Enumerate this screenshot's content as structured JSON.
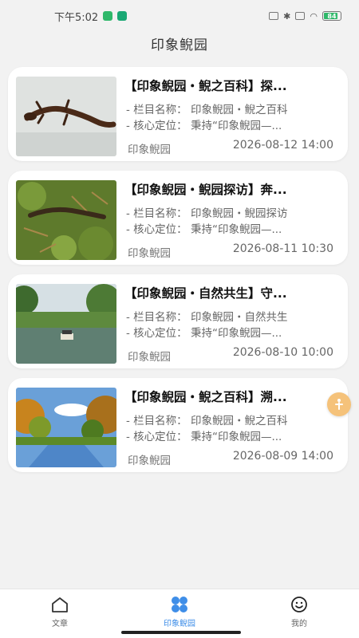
{
  "status_bar": {
    "time": "下午5:02",
    "battery": "84"
  },
  "header": {
    "title": "印象鲵园"
  },
  "articles": [
    {
      "title": "【印象鲵园・鲵之百科】探...",
      "meta1": "- 栏目名称：  印象鲵园・鲵之百科",
      "meta2": "- 核心定位：  秉持“印象鲵园—...",
      "source": "印象鲵园",
      "date": "2026-08-12 14:00"
    },
    {
      "title": "【印象鲵园・鲵园探访】奔...",
      "meta1": "- 栏目名称：  印象鲵园・鲵园探访",
      "meta2": "- 核心定位：  秉持“印象鲵园—...",
      "source": "印象鲵园",
      "date": "2026-08-11 10:30"
    },
    {
      "title": "【印象鲵园・自然共生】守...",
      "meta1": "- 栏目名称：  印象鲵园・自然共生",
      "meta2": "- 核心定位：  秉持“印象鲵园—...",
      "source": "印象鲵园",
      "date": "2026-08-10 10:00"
    },
    {
      "title": "【印象鲵园・鲵之百科】溯...",
      "meta1": "- 栏目名称：  印象鲵园・鲵之百科",
      "meta2": "- 核心定位：  秉持“印象鲵园—...",
      "source": "印象鲵园",
      "date": "2026-08-09 14:00"
    }
  ],
  "bottom_nav": [
    {
      "label": "文章",
      "icon": "home-icon",
      "active": false
    },
    {
      "label": "印象鲵园",
      "icon": "grid-icon",
      "active": true
    },
    {
      "label": "我的",
      "icon": "smiley-icon",
      "active": false
    }
  ],
  "colors": {
    "accent": "#3f8ee8",
    "background": "#f2f2f2",
    "card": "#ffffff",
    "float_button": "#f5c27a"
  }
}
